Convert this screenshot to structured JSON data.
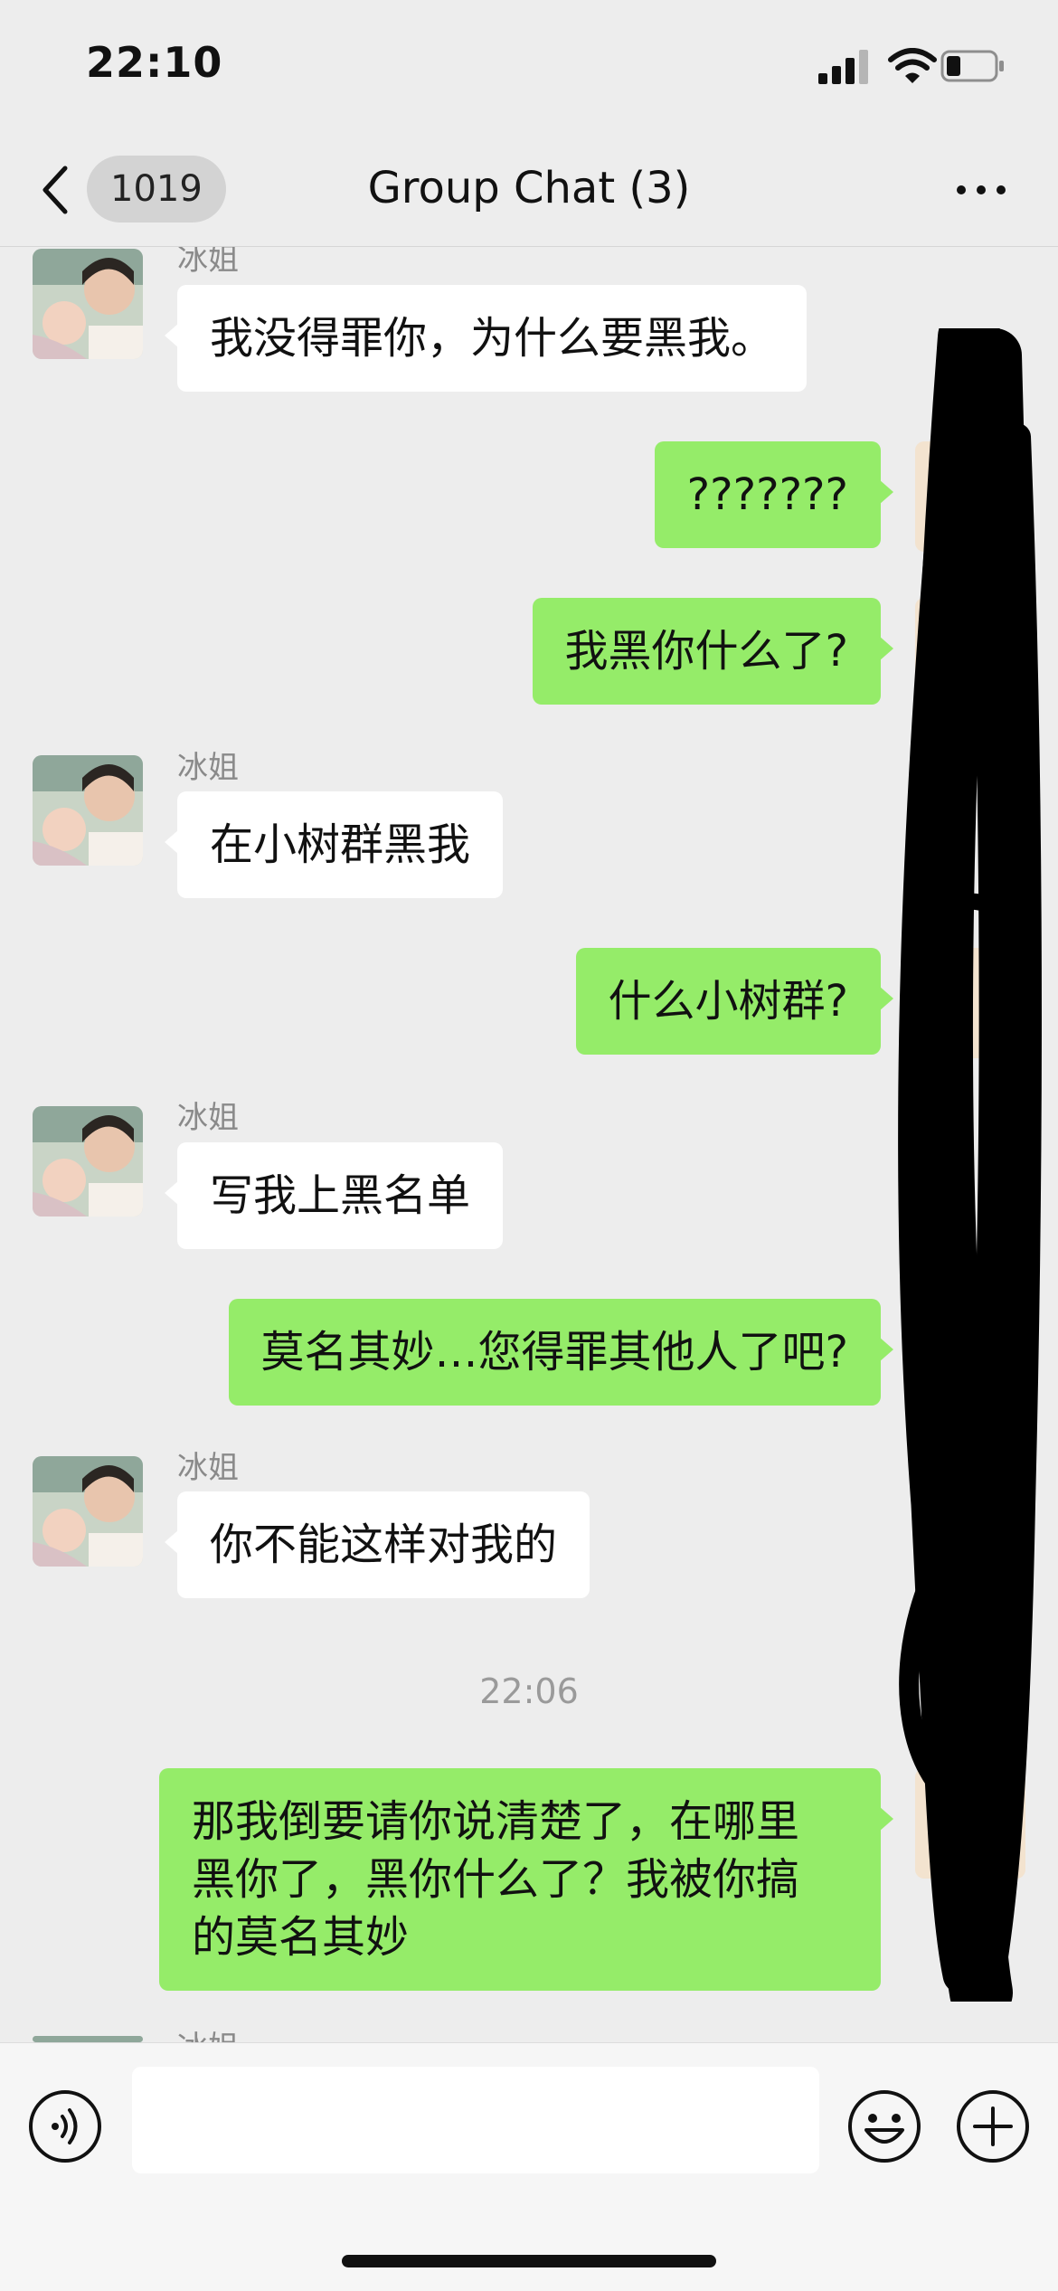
{
  "status_bar": {
    "time": "22:10",
    "icons": [
      "cellular-signal-icon",
      "wifi-icon",
      "battery-icon"
    ]
  },
  "nav": {
    "back_icon": "chevron-left-icon",
    "unread_badge": "1019",
    "title": "Group Chat (3)",
    "more_icon": "more-dots-icon"
  },
  "messages": [
    {
      "direction": "in",
      "sender": "冰姐",
      "text": "我没得罪你，为什么要黑我。"
    },
    {
      "direction": "out",
      "text": "???????"
    },
    {
      "direction": "out",
      "text": "我黑你什么了?"
    },
    {
      "direction": "in",
      "sender": "冰姐",
      "text": "在小树群黑我"
    },
    {
      "direction": "out",
      "text": "什么小树群?"
    },
    {
      "direction": "in",
      "sender": "冰姐",
      "text": "写我上黑名单"
    },
    {
      "direction": "out",
      "text": "莫名其妙…您得罪其他人了吧?"
    },
    {
      "direction": "in",
      "sender": "冰姐",
      "text": "你不能这样对我的"
    },
    {
      "type": "timestamp",
      "text": "22:06"
    },
    {
      "direction": "out",
      "lines": [
        "那我倒要请你说清楚了，在哪里",
        "黑你了，黑你什么了？我被你搞",
        "的莫名其妙"
      ]
    },
    {
      "direction": "in",
      "sender": "冰姐",
      "partial": true
    }
  ],
  "input_bar": {
    "voice_icon": "voice-icon",
    "input_value": "",
    "emoji_icon": "emoji-icon",
    "plus_icon": "plus-icon"
  },
  "colors": {
    "background": "#ededed",
    "outgoing_bubble": "#95ec69",
    "incoming_bubble": "#ffffff",
    "timestamp": "#9a9a9a"
  }
}
